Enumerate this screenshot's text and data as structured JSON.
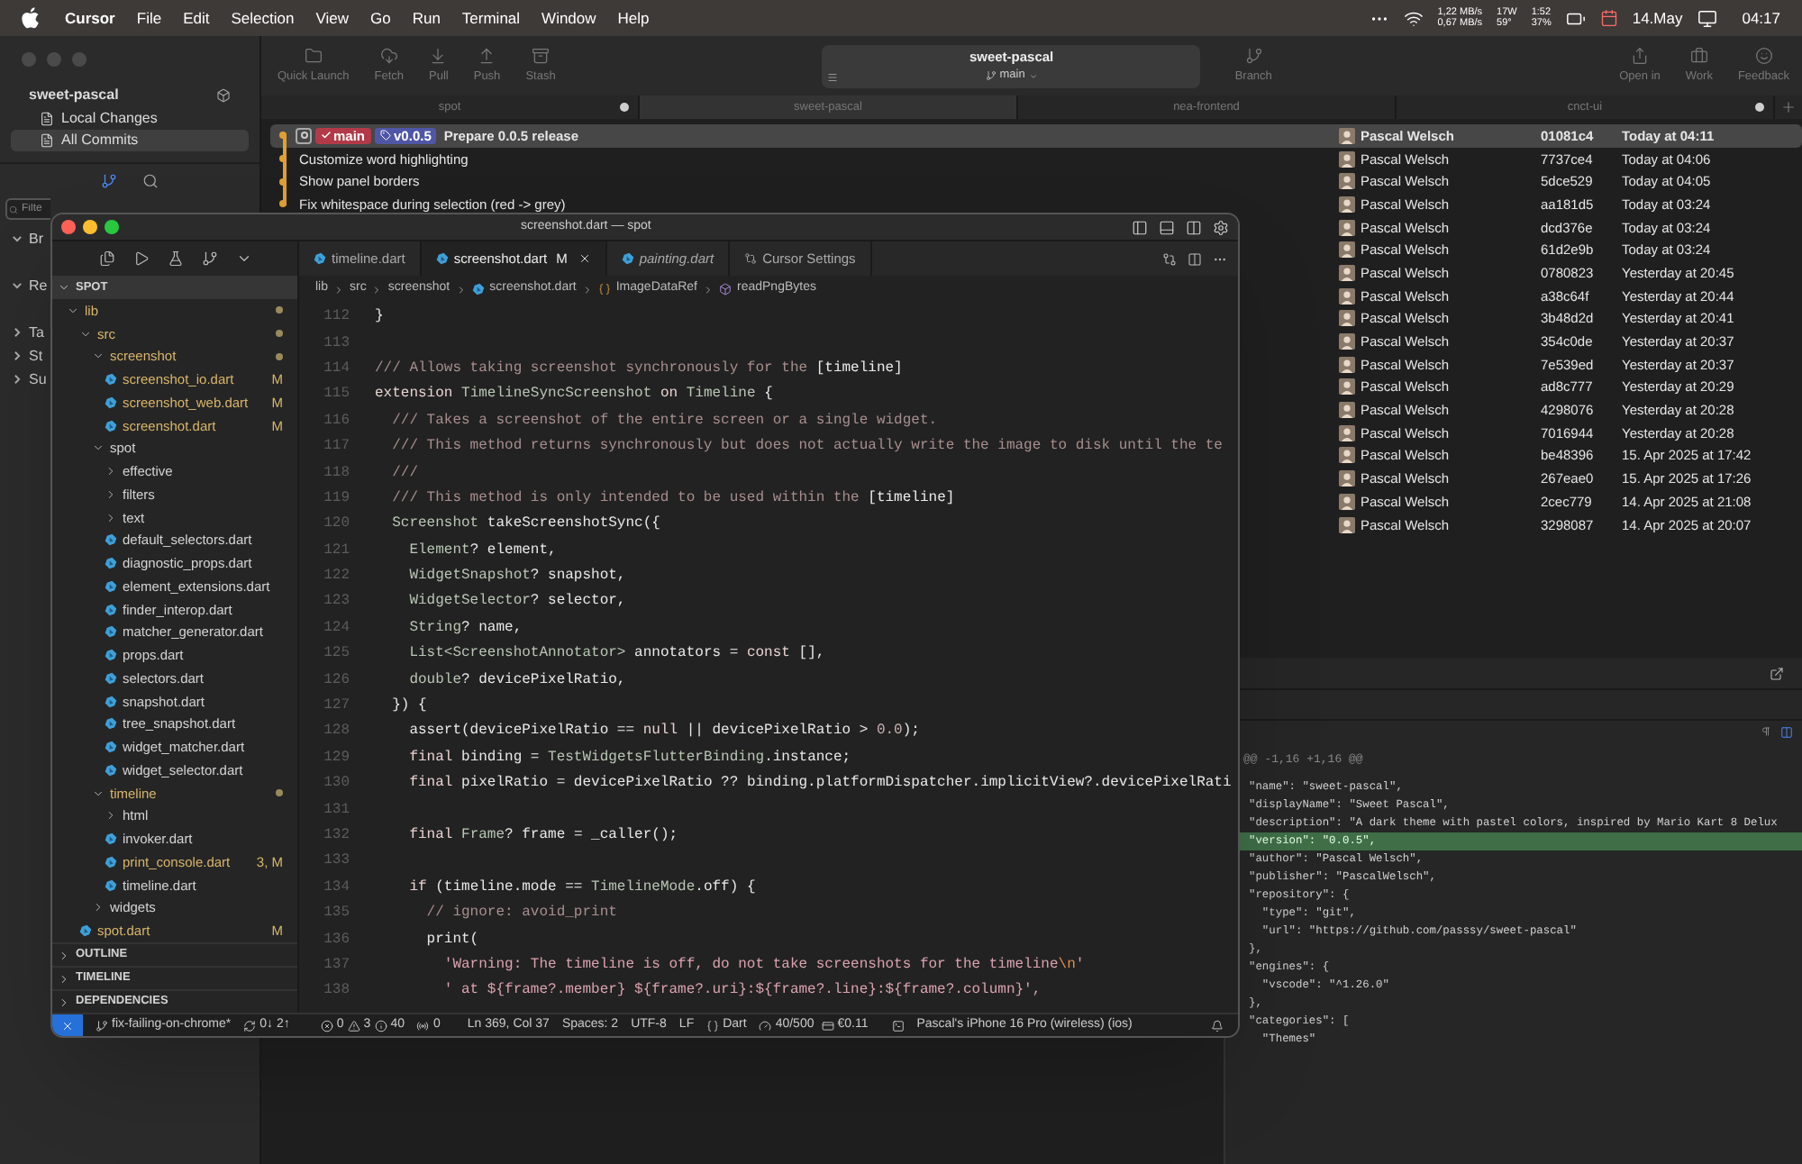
{
  "menu_bar": {
    "app": "Cursor",
    "items": [
      "File",
      "Edit",
      "Selection",
      "View",
      "Go",
      "Run",
      "Terminal",
      "Window",
      "Help"
    ],
    "net_up": "1,22 MB/s",
    "net_down": "0,67 MB/s",
    "power": "17W",
    "temp": "59°",
    "battery_time": "1:52",
    "battery": "37%",
    "date": "14.May",
    "time": "04:17"
  },
  "tower": {
    "repo": "sweet-pascal",
    "nav": [
      {
        "label": "Local Changes",
        "selected": false
      },
      {
        "label": "All Commits",
        "selected": true
      }
    ],
    "filter_placeholder": "Filte",
    "tree": [
      {
        "label": "Br",
        "expanded": true
      },
      {
        "label": "Re",
        "expanded": true
      },
      {
        "label": "Ta",
        "expanded": false
      },
      {
        "label": "St",
        "expanded": false
      },
      {
        "label": "Su",
        "expanded": false
      }
    ],
    "toolbar": [
      "Quick Launch",
      "Fetch",
      "Pull",
      "Push",
      "Stash"
    ],
    "title": "sweet-pascal",
    "branch": "main",
    "branch_button": "Branch",
    "right_toolbar": [
      "Open in",
      "Work",
      "Feedback"
    ],
    "tabs": [
      {
        "label": "spot",
        "selected": false,
        "dot": true
      },
      {
        "label": "sweet-pascal",
        "selected": true,
        "dot": false
      },
      {
        "label": "nea-frontend",
        "selected": false,
        "dot": false
      },
      {
        "label": "cnct-ui",
        "selected": false,
        "dot": true
      }
    ],
    "commits": [
      {
        "message": "Prepare 0.0.5 release",
        "refs": [
          {
            "kind": "branch",
            "label": "main"
          },
          {
            "kind": "tag",
            "label": "v0.0.5"
          }
        ],
        "author": "Pascal Welsch",
        "hash": "01081c4",
        "date": "Today at 04:11",
        "selected": true
      },
      {
        "message": "Customize word highlighting",
        "author": "Pascal Welsch",
        "hash": "7737ce4",
        "date": "Today at 04:06",
        "selected": false
      },
      {
        "message": "Show panel borders",
        "author": "Pascal Welsch",
        "hash": "5dce529",
        "date": "Today at 04:05",
        "selected": false
      },
      {
        "message": "Fix whitespace during selection (red -> grey)",
        "author": "Pascal Welsch",
        "hash": "aa181d5",
        "date": "Today at 03:24",
        "selected": false
      },
      {
        "author": "Pascal Welsch",
        "hash": "dcd376e",
        "date": "Today at 03:24",
        "selected": false
      },
      {
        "author": "Pascal Welsch",
        "hash": "61d2e9b",
        "date": "Today at 03:24",
        "selected": false
      },
      {
        "author": "Pascal Welsch",
        "hash": "0780823",
        "date": "Yesterday at 20:45",
        "selected": false
      },
      {
        "author": "Pascal Welsch",
        "hash": "a38c64f",
        "date": "Yesterday at 20:44",
        "selected": false
      },
      {
        "author": "Pascal Welsch",
        "hash": "3b48d2d",
        "date": "Yesterday at 20:41",
        "selected": false
      },
      {
        "author": "Pascal Welsch",
        "hash": "354c0de",
        "date": "Yesterday at 20:37",
        "selected": false
      },
      {
        "author": "Pascal Welsch",
        "hash": "7e539ed",
        "date": "Yesterday at 20:37",
        "selected": false
      },
      {
        "author": "Pascal Welsch",
        "hash": "ad8c777",
        "date": "Yesterday at 20:29",
        "selected": false
      },
      {
        "author": "Pascal Welsch",
        "hash": "4298076",
        "date": "Yesterday at 20:28",
        "selected": false
      },
      {
        "author": "Pascal Welsch",
        "hash": "7016944",
        "date": "Yesterday at 20:28",
        "selected": false
      },
      {
        "author": "Pascal Welsch",
        "hash": "be48396",
        "date": "15. Apr 2025 at 17:42",
        "selected": false
      },
      {
        "author": "Pascal Welsch",
        "hash": "267eae0",
        "date": "15. Apr 2025 at 17:26",
        "selected": false
      },
      {
        "author": "Pascal Welsch",
        "hash": "2cec779",
        "date": "14. Apr 2025 at 21:08",
        "selected": false
      },
      {
        "author": "Pascal Welsch",
        "hash": "3298087",
        "date": "14. Apr 2025 at 20:07",
        "selected": false
      }
    ],
    "diff": {
      "hunk": "@@ -1,16 +1,16 @@",
      "lines": [
        {
          "text": "\"name\": \"sweet-pascal\",",
          "kind": "context"
        },
        {
          "text": "\"displayName\": \"Sweet Pascal\",",
          "kind": "context"
        },
        {
          "text": "\"description\": \"A dark theme with pastel colors, inspired by Mario Kart 8 Delux",
          "kind": "context"
        },
        {
          "text": "\"version\": \"0.0.5\",",
          "kind": "added"
        },
        {
          "text": "\"author\": \"Pascal Welsch\",",
          "kind": "context"
        },
        {
          "text": "\"publisher\": \"PascalWelsch\",",
          "kind": "context"
        },
        {
          "text": "\"repository\": {",
          "kind": "context"
        },
        {
          "text": "  \"type\": \"git\",",
          "kind": "context"
        },
        {
          "text": "  \"url\": \"https://github.com/passsy/sweet-pascal\"",
          "kind": "context"
        },
        {
          "text": "},",
          "kind": "context"
        },
        {
          "text": "\"engines\": {",
          "kind": "context"
        },
        {
          "text": "  \"vscode\": \"^1.26.0\"",
          "kind": "context"
        },
        {
          "text": "},",
          "kind": "context"
        },
        {
          "text": "\"categories\": [",
          "kind": "context"
        },
        {
          "text": "  \"Themes\"",
          "kind": "context"
        }
      ]
    }
  },
  "editor": {
    "title": "screenshot.dart — spot",
    "explorer": {
      "title": "SPOT",
      "expanded": true,
      "tree": [
        {
          "name": "lib",
          "kind": "folder",
          "expanded": true,
          "modified": true,
          "children": [
            {
              "name": "src",
              "kind": "folder",
              "expanded": true,
              "modified": true,
              "children": [
                {
                  "name": "screenshot",
                  "kind": "folder",
                  "expanded": true,
                  "modified": true,
                  "children": [
                    {
                      "name": "screenshot_io.dart",
                      "kind": "file",
                      "modified": true,
                      "badge": "M"
                    },
                    {
                      "name": "screenshot_web.dart",
                      "kind": "file",
                      "modified": true,
                      "badge": "M"
                    },
                    {
                      "name": "screenshot.dart",
                      "kind": "file",
                      "modified": true,
                      "badge": "M"
                    }
                  ]
                },
                {
                  "name": "spot",
                  "kind": "folder",
                  "expanded": true,
                  "modified": false,
                  "children": [
                    {
                      "name": "effective",
                      "kind": "folder",
                      "expanded": false,
                      "modified": false
                    },
                    {
                      "name": "filters",
                      "kind": "folder",
                      "expanded": false,
                      "modified": false
                    },
                    {
                      "name": "text",
                      "kind": "folder",
                      "expanded": false,
                      "modified": false
                    },
                    {
                      "name": "default_selectors.dart",
                      "kind": "file",
                      "modified": false
                    },
                    {
                      "name": "diagnostic_props.dart",
                      "kind": "file",
                      "modified": false
                    },
                    {
                      "name": "element_extensions.dart",
                      "kind": "file",
                      "modified": false
                    },
                    {
                      "name": "finder_interop.dart",
                      "kind": "file",
                      "modified": false
                    },
                    {
                      "name": "matcher_generator.dart",
                      "kind": "file",
                      "modified": false
                    },
                    {
                      "name": "props.dart",
                      "kind": "file",
                      "modified": false
                    },
                    {
                      "name": "selectors.dart",
                      "kind": "file",
                      "modified": false
                    },
                    {
                      "name": "snapshot.dart",
                      "kind": "file",
                      "modified": false
                    },
                    {
                      "name": "tree_snapshot.dart",
                      "kind": "file",
                      "modified": false
                    },
                    {
                      "name": "widget_matcher.dart",
                      "kind": "file",
                      "modified": false
                    },
                    {
                      "name": "widget_selector.dart",
                      "kind": "file",
                      "modified": false
                    }
                  ]
                },
                {
                  "name": "timeline",
                  "kind": "folder",
                  "expanded": true,
                  "modified": true,
                  "children": [
                    {
                      "name": "html",
                      "kind": "folder",
                      "expanded": false,
                      "modified": false
                    },
                    {
                      "name": "invoker.dart",
                      "kind": "file",
                      "modified": false
                    },
                    {
                      "name": "print_console.dart",
                      "kind": "file",
                      "modified": true,
                      "badge": "3, M"
                    },
                    {
                      "name": "timeline.dart",
                      "kind": "file",
                      "modified": false
                    }
                  ]
                },
                {
                  "name": "widgets",
                  "kind": "folder",
                  "expanded": false,
                  "modified": false
                }
              ]
            },
            {
              "name": "spot.dart",
              "kind": "file",
              "modified": true,
              "badge": "M"
            }
          ]
        }
      ]
    },
    "sections": [
      {
        "title": "OUTLINE",
        "expanded": false
      },
      {
        "title": "TIMELINE",
        "expanded": false
      },
      {
        "title": "DEPENDENCIES",
        "expanded": false
      }
    ],
    "tabs": [
      {
        "label": "timeline.dart",
        "kind": "dart",
        "selected": false,
        "preview": false
      },
      {
        "label": "screenshot.dart",
        "badge": "M",
        "kind": "dart",
        "selected": true,
        "preview": false
      },
      {
        "label": "painting.dart",
        "kind": "dart",
        "selected": false,
        "preview": true
      },
      {
        "label": "Cursor Settings",
        "kind": "settings",
        "selected": false,
        "preview": false
      }
    ],
    "breadcrumb": [
      {
        "label": "lib",
        "kind": "folder"
      },
      {
        "label": "src",
        "kind": "folder"
      },
      {
        "label": "screenshot",
        "kind": "folder"
      },
      {
        "label": "screenshot.dart",
        "kind": "file"
      },
      {
        "label": "ImageDataRef",
        "kind": "class"
      },
      {
        "label": "readPngBytes",
        "kind": "method"
      }
    ],
    "code": [
      {
        "number": "112",
        "tokens": [
          {
            "kind": "plain",
            "text": "}"
          }
        ]
      },
      {
        "number": "113"
      },
      {
        "number": "114",
        "tokens": [
          {
            "kind": "comment",
            "text": "/// Allows taking screenshot synchronously for the "
          },
          {
            "kind": "reference",
            "text": "[timeline]"
          }
        ]
      },
      {
        "number": "115",
        "tokens": [
          {
            "kind": "keyword",
            "text": "extension "
          },
          {
            "kind": "type",
            "text": "TimelineSyncScreenshot "
          },
          {
            "kind": "keyword",
            "text": "on "
          },
          {
            "kind": "type",
            "text": "Timeline "
          },
          {
            "kind": "plain",
            "text": "{"
          }
        ]
      },
      {
        "number": "116",
        "tokens": [
          {
            "kind": "comment",
            "text": "  /// Takes a screenshot of the entire screen or a single widget."
          }
        ]
      },
      {
        "number": "117",
        "tokens": [
          {
            "kind": "comment",
            "text": "  /// This method returns synchronously but does not actually write the image to disk until the te"
          }
        ]
      },
      {
        "number": "118",
        "tokens": [
          {
            "kind": "comment",
            "text": "  ///"
          }
        ]
      },
      {
        "number": "119",
        "tokens": [
          {
            "kind": "comment",
            "text": "  /// This method is only intended to be used within the "
          },
          {
            "kind": "reference",
            "text": "[timeline]"
          }
        ]
      },
      {
        "number": "120",
        "tokens": [
          {
            "kind": "type",
            "text": "  Screenshot "
          },
          {
            "kind": "plain",
            "text": "takeScreenshotSync({"
          }
        ]
      },
      {
        "number": "121",
        "tokens": [
          {
            "kind": "type",
            "text": "    Element"
          },
          {
            "kind": "plain",
            "text": "? element,"
          }
        ]
      },
      {
        "number": "122",
        "tokens": [
          {
            "kind": "type",
            "text": "    WidgetSnapshot"
          },
          {
            "kind": "plain",
            "text": "? snapshot,"
          }
        ]
      },
      {
        "number": "123",
        "tokens": [
          {
            "kind": "type",
            "text": "    WidgetSelector"
          },
          {
            "kind": "plain",
            "text": "? selector,"
          }
        ]
      },
      {
        "number": "124",
        "tokens": [
          {
            "kind": "type",
            "text": "    String"
          },
          {
            "kind": "plain",
            "text": "? name,"
          }
        ]
      },
      {
        "number": "125",
        "tokens": [
          {
            "kind": "type",
            "text": "    List<ScreenshotAnnotator>"
          },
          {
            "kind": "plain",
            "text": " annotators = "
          },
          {
            "kind": "keyword",
            "text": "const"
          },
          {
            "kind": "plain",
            "text": " [],"
          }
        ]
      },
      {
        "number": "126",
        "tokens": [
          {
            "kind": "type",
            "text": "    double"
          },
          {
            "kind": "plain",
            "text": "? devicePixelRatio,"
          }
        ]
      },
      {
        "number": "127",
        "tokens": [
          {
            "kind": "plain",
            "text": "  }) {"
          }
        ]
      },
      {
        "number": "128",
        "tokens": [
          {
            "kind": "plain",
            "text": "    assert(devicePixelRatio == "
          },
          {
            "kind": "keyword",
            "text": "null"
          },
          {
            "kind": "plain",
            "text": " || devicePixelRatio > "
          },
          {
            "kind": "number",
            "text": "0.0"
          },
          {
            "kind": "plain",
            "text": ");"
          }
        ]
      },
      {
        "number": "129",
        "tokens": [
          {
            "kind": "keyword",
            "text": "    final "
          },
          {
            "kind": "plain",
            "text": "binding = "
          },
          {
            "kind": "type",
            "text": "TestWidgetsFlutterBinding"
          },
          {
            "kind": "plain",
            "text": ".instance;"
          }
        ]
      },
      {
        "number": "130",
        "tokens": [
          {
            "kind": "keyword",
            "text": "    final "
          },
          {
            "kind": "plain",
            "text": "pixelRatio = devicePixelRatio ?? binding.platformDispatcher.implicitView?.devicePixelRati"
          }
        ]
      },
      {
        "number": "131"
      },
      {
        "number": "132",
        "tokens": [
          {
            "kind": "keyword",
            "text": "    final "
          },
          {
            "kind": "type",
            "text": "Frame"
          },
          {
            "kind": "plain",
            "text": "? frame = _caller();"
          }
        ]
      },
      {
        "number": "133"
      },
      {
        "number": "134",
        "tokens": [
          {
            "kind": "keyword",
            "text": "    if "
          },
          {
            "kind": "plain",
            "text": "(timeline.mode == "
          },
          {
            "kind": "type",
            "text": "TimelineMode"
          },
          {
            "kind": "plain",
            "text": ".off) {"
          }
        ]
      },
      {
        "number": "135",
        "tokens": [
          {
            "kind": "comment",
            "text": "      // ignore: avoid_print"
          }
        ]
      },
      {
        "number": "136",
        "tokens": [
          {
            "kind": "plain",
            "text": "      print("
          }
        ]
      },
      {
        "number": "137",
        "tokens": [
          {
            "kind": "string",
            "text": "        'Warning: The timeline is off, do not take screenshots for the timeline"
          },
          {
            "kind": "escape",
            "text": "\\n"
          },
          {
            "kind": "string",
            "text": "'"
          }
        ]
      },
      {
        "number": "138",
        "tokens": [
          {
            "kind": "string",
            "text": "        ' at ${frame?.member} ${frame?.uri}:${frame?.line}:${frame?.column}',"
          }
        ]
      }
    ],
    "status_bar": {
      "branch": "fix-failing-on-chrome*",
      "sync": "0↓ 2↑",
      "errors": "0",
      "warnings": "3",
      "infos": "40",
      "ports": "0",
      "position": "Ln 369, Col 37",
      "indent": "Spaces: 2",
      "encoding": "UTF-8",
      "eol": "LF",
      "language": "Dart",
      "tokens": "40/500",
      "cost": "€0.11",
      "device": "Pascal's iPhone 16 Pro (wireless) (ios)"
    }
  }
}
